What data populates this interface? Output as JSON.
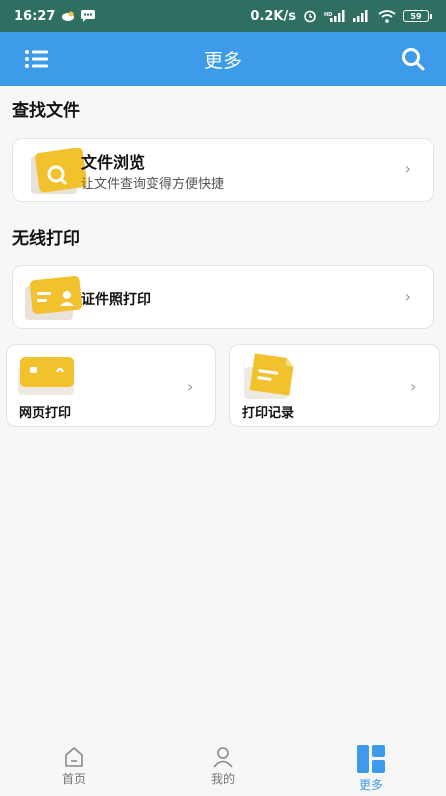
{
  "status_bar": {
    "time": "16:27",
    "network_speed": "0.2K/s",
    "battery": "59"
  },
  "app_bar": {
    "title": "更多",
    "menu_icon": "list-menu-icon",
    "search_icon": "search-icon"
  },
  "sections": {
    "find_files": {
      "title": "查找文件"
    },
    "wireless_print": {
      "title": "无线打印"
    }
  },
  "cards": {
    "file_browse": {
      "title": "文件浏览",
      "subtitle": "让文件查询变得方便快捷"
    },
    "id_photo_print": {
      "title": "证件照打印"
    },
    "web_print": {
      "title": "网页打印"
    },
    "print_history": {
      "title": "打印记录"
    }
  },
  "chevron": "›",
  "tabs": [
    {
      "label": "首页",
      "icon": "home-icon"
    },
    {
      "label": "我的",
      "icon": "user-icon"
    },
    {
      "label": "更多",
      "icon": "grid-more-icon"
    }
  ],
  "colors": {
    "accent": "#3d9be9",
    "status_bar": "#2f6f62",
    "card_icon": "#f2c12e"
  }
}
